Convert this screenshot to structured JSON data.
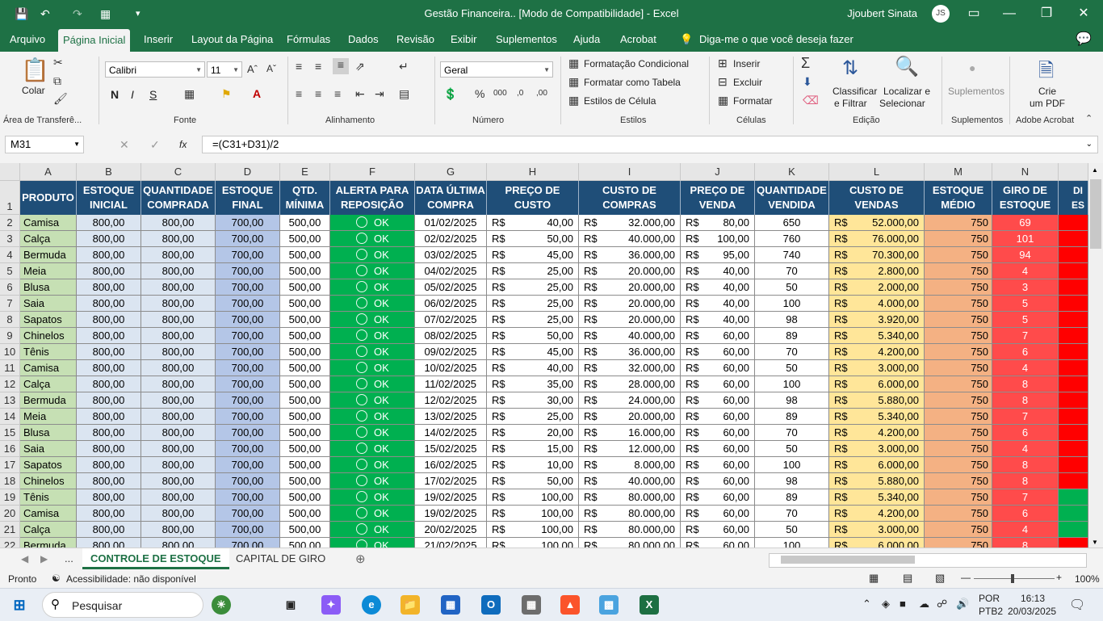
{
  "app": {
    "title": "Gestão Financeira..  [Modo de Compatibilidade]  -  Excel",
    "user": "Jjoubert Sinata",
    "user_initials": "JS"
  },
  "menu": [
    "Arquivo",
    "Página Inicial",
    "Inserir",
    "Layout da Página",
    "Fórmulas",
    "Dados",
    "Revisão",
    "Exibir",
    "Suplementos",
    "Ajuda",
    "Acrobat"
  ],
  "menu_tell": "Diga-me o que você deseja fazer",
  "ribbon": {
    "paste": "Colar",
    "clipboard": "Área de Transferê...",
    "font_name": "Calibri",
    "font_size": "11",
    "font_group": "Fonte",
    "bold": "N",
    "italic": "I",
    "underline": "S",
    "align_group": "Alinhamento",
    "number_format": "Geral",
    "number_group": "Número",
    "cond_format": "Formatação Condicional",
    "format_table": "Formatar como Tabela",
    "cell_styles": "Estilos de Célula",
    "styles_group": "Estilos",
    "insert": "Inserir",
    "delete": "Excluir",
    "format": "Formatar",
    "cells_group": "Células",
    "sort1": "Classificar",
    "sort2": "e Filtrar",
    "find1": "Localizar e",
    "find2": "Selecionar",
    "edit_group": "Edição",
    "addins": "Suplementos",
    "addins_group": "Suplementos",
    "pdf1": "Crie",
    "pdf2": "um PDF",
    "acrobat_group": "Adobe Acrobat"
  },
  "formula": {
    "name_box": "M31",
    "fx": "fx",
    "content": "=(C31+D31)/2"
  },
  "columns": [
    "A",
    "B",
    "C",
    "D",
    "E",
    "F",
    "G",
    "H",
    "I",
    "J",
    "K",
    "L",
    "M",
    "N"
  ],
  "headers": [
    "PRODUTO",
    "ESTOQUE INICIAL",
    "QUANTIDADE COMPRADA",
    "ESTOQUE FINAL",
    "QTD. MÍNIMA",
    "ALERTA PARA REPOSIÇÃO",
    "DATA ÚLTIMA COMPRA",
    "PREÇO DE CUSTO",
    "CUSTO DE COMPRAS",
    "PREÇO DE VENDA",
    "QUANTIDADE VENDIDA",
    "CUSTO DE VENDAS",
    "ESTOQUE MÉDIO",
    "GIRO DE ESTOQUE",
    "DI ES"
  ],
  "currency": "R$",
  "rows": [
    [
      "Camisa",
      "800,00",
      "800,00",
      "700,00",
      "500,00",
      "OK",
      "01/02/2025",
      "40,00",
      "32.000,00",
      "80,00",
      "650",
      "52.000,00",
      "750",
      "69"
    ],
    [
      "Calça",
      "800,00",
      "800,00",
      "700,00",
      "500,00",
      "OK",
      "02/02/2025",
      "50,00",
      "40.000,00",
      "100,00",
      "760",
      "76.000,00",
      "750",
      "101"
    ],
    [
      "Bermuda",
      "800,00",
      "800,00",
      "700,00",
      "500,00",
      "OK",
      "03/02/2025",
      "45,00",
      "36.000,00",
      "95,00",
      "740",
      "70.300,00",
      "750",
      "94"
    ],
    [
      "Meia",
      "800,00",
      "800,00",
      "700,00",
      "500,00",
      "OK",
      "04/02/2025",
      "25,00",
      "20.000,00",
      "40,00",
      "70",
      "2.800,00",
      "750",
      "4"
    ],
    [
      "Blusa",
      "800,00",
      "800,00",
      "700,00",
      "500,00",
      "OK",
      "05/02/2025",
      "25,00",
      "20.000,00",
      "40,00",
      "50",
      "2.000,00",
      "750",
      "3"
    ],
    [
      "Saia",
      "800,00",
      "800,00",
      "700,00",
      "500,00",
      "OK",
      "06/02/2025",
      "25,00",
      "20.000,00",
      "40,00",
      "100",
      "4.000,00",
      "750",
      "5"
    ],
    [
      "Sapatos",
      "800,00",
      "800,00",
      "700,00",
      "500,00",
      "OK",
      "07/02/2025",
      "25,00",
      "20.000,00",
      "40,00",
      "98",
      "3.920,00",
      "750",
      "5"
    ],
    [
      "Chinelos",
      "800,00",
      "800,00",
      "700,00",
      "500,00",
      "OK",
      "08/02/2025",
      "50,00",
      "40.000,00",
      "60,00",
      "89",
      "5.340,00",
      "750",
      "7"
    ],
    [
      "Tênis",
      "800,00",
      "800,00",
      "700,00",
      "500,00",
      "OK",
      "09/02/2025",
      "45,00",
      "36.000,00",
      "60,00",
      "70",
      "4.200,00",
      "750",
      "6"
    ],
    [
      "Camisa",
      "800,00",
      "800,00",
      "700,00",
      "500,00",
      "OK",
      "10/02/2025",
      "40,00",
      "32.000,00",
      "60,00",
      "50",
      "3.000,00",
      "750",
      "4"
    ],
    [
      "Calça",
      "800,00",
      "800,00",
      "700,00",
      "500,00",
      "OK",
      "11/02/2025",
      "35,00",
      "28.000,00",
      "60,00",
      "100",
      "6.000,00",
      "750",
      "8"
    ],
    [
      "Bermuda",
      "800,00",
      "800,00",
      "700,00",
      "500,00",
      "OK",
      "12/02/2025",
      "30,00",
      "24.000,00",
      "60,00",
      "98",
      "5.880,00",
      "750",
      "8"
    ],
    [
      "Meia",
      "800,00",
      "800,00",
      "700,00",
      "500,00",
      "OK",
      "13/02/2025",
      "25,00",
      "20.000,00",
      "60,00",
      "89",
      "5.340,00",
      "750",
      "7"
    ],
    [
      "Blusa",
      "800,00",
      "800,00",
      "700,00",
      "500,00",
      "OK",
      "14/02/2025",
      "20,00",
      "16.000,00",
      "60,00",
      "70",
      "4.200,00",
      "750",
      "6"
    ],
    [
      "Saia",
      "800,00",
      "800,00",
      "700,00",
      "500,00",
      "OK",
      "15/02/2025",
      "15,00",
      "12.000,00",
      "60,00",
      "50",
      "3.000,00",
      "750",
      "4"
    ],
    [
      "Sapatos",
      "800,00",
      "800,00",
      "700,00",
      "500,00",
      "OK",
      "16/02/2025",
      "10,00",
      "8.000,00",
      "60,00",
      "100",
      "6.000,00",
      "750",
      "8"
    ],
    [
      "Chinelos",
      "800,00",
      "800,00",
      "700,00",
      "500,00",
      "OK",
      "17/02/2025",
      "50,00",
      "40.000,00",
      "60,00",
      "98",
      "5.880,00",
      "750",
      "8"
    ],
    [
      "Tênis",
      "800,00",
      "800,00",
      "700,00",
      "500,00",
      "OK",
      "19/02/2025",
      "100,00",
      "80.000,00",
      "60,00",
      "89",
      "5.340,00",
      "750",
      "7"
    ],
    [
      "Camisa",
      "800,00",
      "800,00",
      "700,00",
      "500,00",
      "OK",
      "19/02/2025",
      "100,00",
      "80.000,00",
      "60,00",
      "70",
      "4.200,00",
      "750",
      "6"
    ],
    [
      "Calça",
      "800,00",
      "800,00",
      "700,00",
      "500,00",
      "OK",
      "20/02/2025",
      "100,00",
      "80.000,00",
      "60,00",
      "50",
      "3.000,00",
      "750",
      "4"
    ],
    [
      "Bermuda",
      "800,00",
      "800,00",
      "700,00",
      "500,00",
      "OK",
      "21/02/2025",
      "100,00",
      "80.000,00",
      "60,00",
      "100",
      "6.000,00",
      "750",
      "8"
    ]
  ],
  "o_colors": [
    "#ff0000",
    "#ff0000",
    "#ff0000",
    "#ff0000",
    "#ff0000",
    "#ff0000",
    "#ff0000",
    "#ff0000",
    "#ff0000",
    "#ff0000",
    "#ff0000",
    "#ff0000",
    "#ff0000",
    "#ff0000",
    "#ff0000",
    "#ff0000",
    "#ff0000",
    "#00b050",
    "#00b050",
    "#00b050",
    "#ff0000"
  ],
  "tabs": {
    "more": "...",
    "active": "CONTROLE DE ESTOQUE",
    "other": "CAPITAL DE GIRO"
  },
  "status": {
    "ready": "Pronto",
    "accessibility": "Acessibilidade: não disponível",
    "zoom": "100%"
  },
  "taskbar": {
    "search": "Pesquisar",
    "lang1": "POR",
    "lang2": "PTB2",
    "time": "16:13",
    "date": "20/03/2025"
  }
}
